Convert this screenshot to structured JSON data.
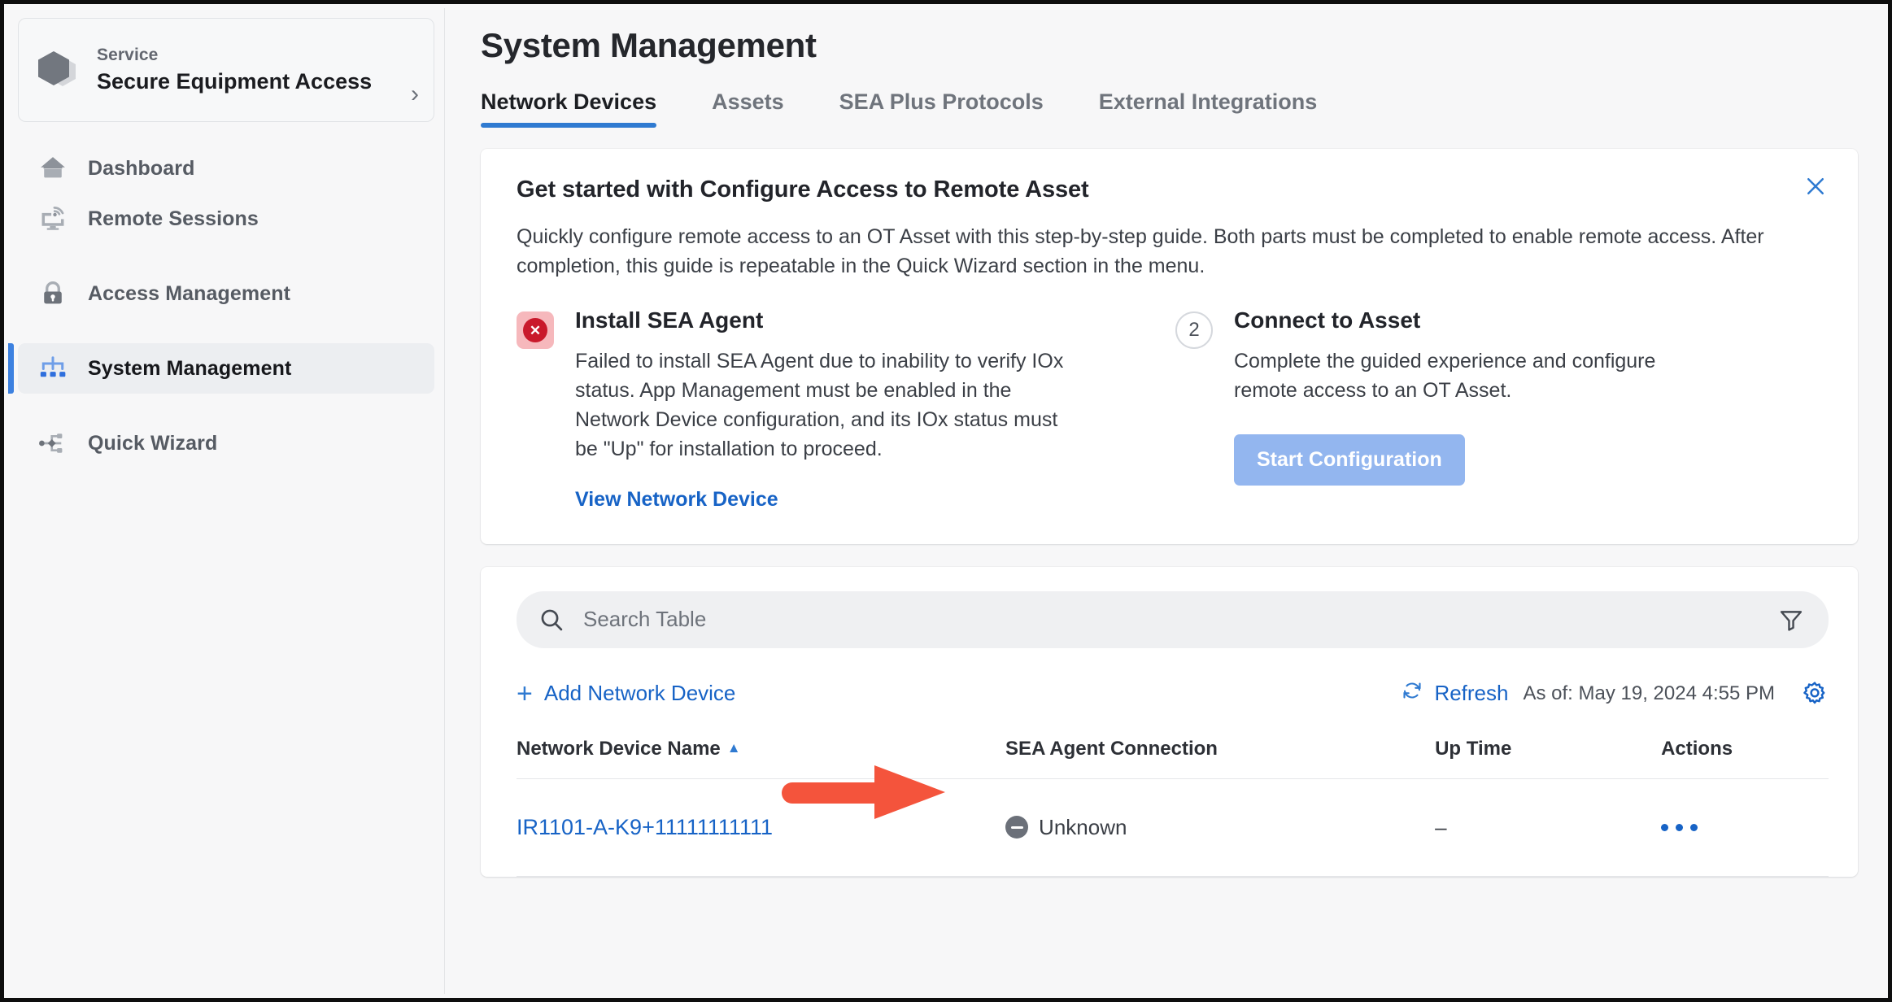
{
  "sidebar": {
    "service": {
      "label": "Service",
      "name": "Secure Equipment Access",
      "chevron": "›",
      "icon": "hexagon-service-icon"
    },
    "items": [
      {
        "label": "Dashboard",
        "icon": "home-icon",
        "active": false
      },
      {
        "label": "Remote Sessions",
        "icon": "remote-monitor-icon",
        "active": false
      },
      {
        "label": "Access Management",
        "icon": "lock-icon",
        "active": false
      },
      {
        "label": "System Management",
        "icon": "system-nodes-icon",
        "active": true
      },
      {
        "label": "Quick Wizard",
        "icon": "wizard-nodes-icon",
        "active": false
      }
    ]
  },
  "header": {
    "title": "System Management",
    "tabs": [
      {
        "label": "Network Devices",
        "active": true
      },
      {
        "label": "Assets",
        "active": false
      },
      {
        "label": "SEA Plus Protocols",
        "active": false
      },
      {
        "label": "External Integrations",
        "active": false
      }
    ]
  },
  "get_started": {
    "title": "Get started with Configure Access to Remote Asset",
    "description": "Quickly configure remote access to an OT Asset with this step-by-step guide. Both parts must be completed to enable remote access. After completion, this guide is repeatable in the Quick Wizard section in the menu.",
    "close_icon": "close-icon",
    "steps": [
      {
        "badge": "✕",
        "badge_state": "error",
        "title": "Install SEA Agent",
        "description": "Failed to install SEA Agent due to inability to verify IOx status. App Management must be enabled in the Network Device configuration, and its IOx status must be \"Up\" for installation to proceed.",
        "link_label": "View Network Device"
      },
      {
        "badge": "2",
        "badge_state": "pending",
        "title": "Connect to Asset",
        "description": "Complete the guided experience and configure remote access to an OT Asset.",
        "button_label": "Start Configuration"
      }
    ]
  },
  "table_panel": {
    "search": {
      "placeholder": "Search Table",
      "value": "",
      "icon": "search-icon"
    },
    "filter_icon": "filter-funnel-icon",
    "add_label": "Add Network Device",
    "add_icon": "plus-icon",
    "refresh_label": "Refresh",
    "refresh_icon": "refresh-icon",
    "as_of": "As of: May 19, 2024 4:55 PM",
    "settings_icon": "gear-icon",
    "columns": [
      {
        "label": "Network Device Name",
        "sorted": "asc",
        "sort_glyph": "▲"
      },
      {
        "label": "SEA Agent Connection",
        "sorted": "none"
      },
      {
        "label": "Up Time",
        "sorted": "none"
      },
      {
        "label": "Actions",
        "sorted": "none"
      }
    ],
    "rows": [
      {
        "name": "IR1101-A-K9+11111111111",
        "connection": "Unknown",
        "connection_icon": "minus-circle-icon",
        "uptime": "–",
        "actions_icon": "more-actions-icon"
      }
    ]
  },
  "annotation": {
    "type": "arrow",
    "color": "#f4543c",
    "points_to": "Add Network Device"
  },
  "colors": {
    "accent_blue": "#2f7ad1",
    "link_blue": "#1763c6",
    "error_red": "#c9192b",
    "error_bg": "#f6b8bc",
    "button_disabled_blue": "#93b6ef",
    "annotation_red": "#f4543c",
    "page_bg": "#f7f7f8",
    "card_bg": "#ffffff"
  }
}
